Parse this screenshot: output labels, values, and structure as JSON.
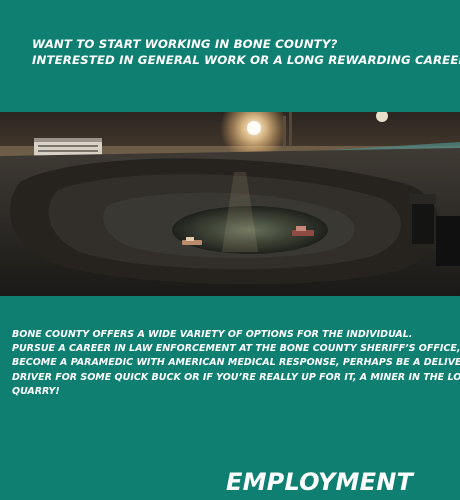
{
  "header": {
    "line1": "WANT TO START WORKING IN BONE COUNTY?",
    "line2": "INTERESTED IN GENERAL WORK OR A LONG REWARDING CAREER?"
  },
  "body": {
    "lines": [
      "BONE COUNTY OFFERS A WIDE VARIETY OF OPTIONS FOR THE INDIVIDUAL.",
      "PURSUE A CAREER IN LAW ENFORCEMENT AT THE BONE COUNTY SHERIFF’S OFFICE,",
      "BECOME A PARAMEDIC WITH AMERICAN MEDICAL RESPONSE, PERHAPS BE A DELIVERY",
      "DRIVER FOR SOME QUICK BUCK OR IF YOU’RE REALLY UP FOR IT, A MINER IN THE LOCAL",
      "QUARRY!"
    ]
  },
  "footer": {
    "title": "EMPLOYMENT"
  },
  "colors": {
    "background": "#0f7f72",
    "text": "#ffffff"
  }
}
